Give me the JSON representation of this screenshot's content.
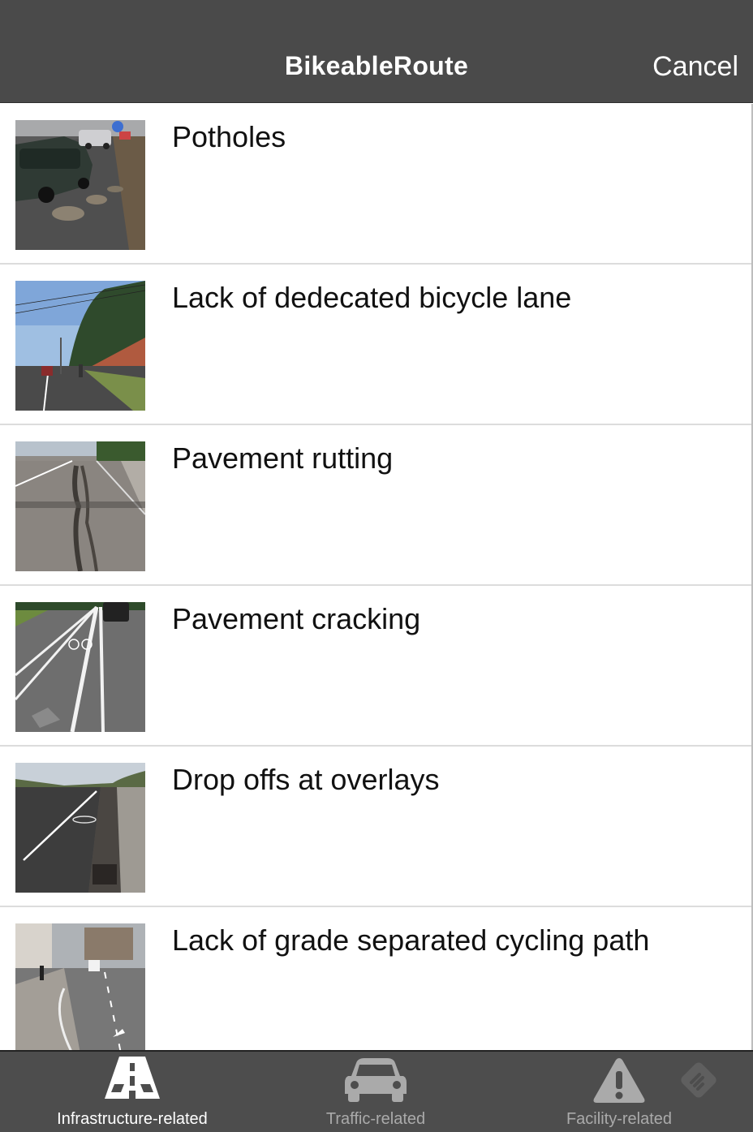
{
  "header": {
    "title": "BikeableRoute",
    "cancel_label": "Cancel"
  },
  "issues": [
    {
      "label": "Potholes",
      "thumb": "potholes-photo"
    },
    {
      "label": "Lack of dedecated bicycle lane",
      "thumb": "no-bike-lane-photo"
    },
    {
      "label": "Pavement rutting",
      "thumb": "rutting-photo"
    },
    {
      "label": "Pavement cracking",
      "thumb": "cracking-photo"
    },
    {
      "label": "Drop offs at overlays",
      "thumb": "drop-off-photo"
    },
    {
      "label": "Lack of grade separated cycling path",
      "thumb": "grade-separation-photo"
    }
  ],
  "tabs": [
    {
      "label": "Infrastructure-related",
      "icon": "road-icon",
      "active": true
    },
    {
      "label": "Traffic-related",
      "icon": "car-icon",
      "active": false
    },
    {
      "label": "Facility-related",
      "icon": "warning-icon",
      "active": false
    }
  ],
  "colors": {
    "header_bg": "#4a4a4a",
    "tabbar_bg": "#4d4d4d",
    "active_tab": "#ffffff",
    "inactive_tab": "#aaaaaa"
  }
}
